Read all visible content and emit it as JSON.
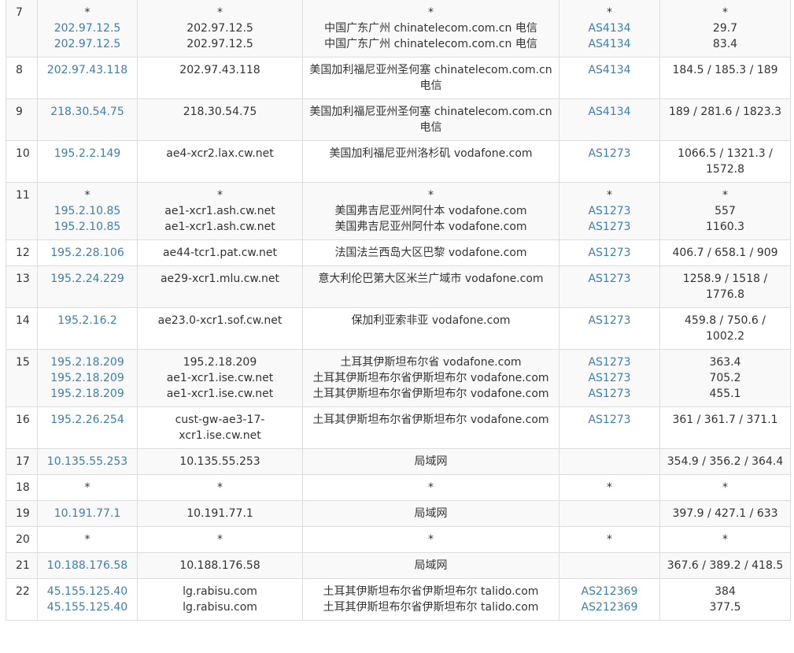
{
  "table": {
    "rows": [
      {
        "hop": "7",
        "ip": [
          "*",
          "202.97.12.5",
          "202.97.12.5"
        ],
        "host": [
          "*",
          "202.97.12.5",
          "202.97.12.5"
        ],
        "loc": [
          "*",
          "中国广东广州 chinatelecom.com.cn 电信",
          "中国广东广州 chinatelecom.com.cn 电信"
        ],
        "asn": [
          "*",
          "AS4134",
          "AS4134"
        ],
        "time": [
          "*",
          "29.7",
          "83.4"
        ]
      },
      {
        "hop": "8",
        "ip": [
          "202.97.43.118"
        ],
        "host": [
          "202.97.43.118"
        ],
        "loc": [
          "美国加利福尼亚州圣何塞 chinatelecom.com.cn 电信"
        ],
        "asn": [
          "AS4134"
        ],
        "time": [
          "184.5 / 185.3 / 189"
        ]
      },
      {
        "hop": "9",
        "ip": [
          "218.30.54.75"
        ],
        "host": [
          "218.30.54.75"
        ],
        "loc": [
          "美国加利福尼亚州圣何塞 chinatelecom.com.cn 电信"
        ],
        "asn": [
          "AS4134"
        ],
        "time": [
          "189 / 281.6 / 1823.3"
        ]
      },
      {
        "hop": "10",
        "ip": [
          "195.2.2.149"
        ],
        "host": [
          "ae4-xcr2.lax.cw.net"
        ],
        "loc": [
          "美国加利福尼亚州洛杉矶 vodafone.com"
        ],
        "asn": [
          "AS1273"
        ],
        "time": [
          "1066.5 / 1321.3 / 1572.8"
        ]
      },
      {
        "hop": "11",
        "ip": [
          "*",
          "195.2.10.85",
          "195.2.10.85"
        ],
        "host": [
          "*",
          "ae1-xcr1.ash.cw.net",
          "ae1-xcr1.ash.cw.net"
        ],
        "loc": [
          "*",
          "美国弗吉尼亚州阿什本 vodafone.com",
          "美国弗吉尼亚州阿什本 vodafone.com"
        ],
        "asn": [
          "*",
          "AS1273",
          "AS1273"
        ],
        "time": [
          "*",
          "557",
          "1160.3"
        ]
      },
      {
        "hop": "12",
        "ip": [
          "195.2.28.106"
        ],
        "host": [
          "ae44-tcr1.pat.cw.net"
        ],
        "loc": [
          "法国法兰西岛大区巴黎 vodafone.com"
        ],
        "asn": [
          "AS1273"
        ],
        "time": [
          "406.7 / 658.1 / 909"
        ]
      },
      {
        "hop": "13",
        "ip": [
          "195.2.24.229"
        ],
        "host": [
          "ae29-xcr1.mlu.cw.net"
        ],
        "loc": [
          "意大利伦巴第大区米兰广域市 vodafone.com"
        ],
        "asn": [
          "AS1273"
        ],
        "time": [
          "1258.9 / 1518 / 1776.8"
        ]
      },
      {
        "hop": "14",
        "ip": [
          "195.2.16.2"
        ],
        "host": [
          "ae23.0-xcr1.sof.cw.net"
        ],
        "loc": [
          "保加利亚索非亚 vodafone.com"
        ],
        "asn": [
          "AS1273"
        ],
        "time": [
          "459.8 / 750.6 / 1002.2"
        ]
      },
      {
        "hop": "15",
        "ip": [
          "195.2.18.209",
          "195.2.18.209",
          "195.2.18.209"
        ],
        "host": [
          "195.2.18.209",
          "ae1-xcr1.ise.cw.net",
          "ae1-xcr1.ise.cw.net"
        ],
        "loc": [
          "土耳其伊斯坦布尔省 vodafone.com",
          "土耳其伊斯坦布尔省伊斯坦布尔 vodafone.com",
          "土耳其伊斯坦布尔省伊斯坦布尔 vodafone.com"
        ],
        "asn": [
          "AS1273",
          "AS1273",
          "AS1273"
        ],
        "time": [
          "363.4",
          "705.2",
          "455.1"
        ]
      },
      {
        "hop": "16",
        "ip": [
          "195.2.26.254"
        ],
        "host": [
          "cust-gw-ae3-17-xcr1.ise.cw.net"
        ],
        "loc": [
          "土耳其伊斯坦布尔省伊斯坦布尔 vodafone.com"
        ],
        "asn": [
          "AS1273"
        ],
        "time": [
          "361 / 361.7 / 371.1"
        ]
      },
      {
        "hop": "17",
        "ip": [
          "10.135.55.253"
        ],
        "host": [
          "10.135.55.253"
        ],
        "loc": [
          "局域网"
        ],
        "asn": [],
        "time": [
          "354.9 / 356.2 / 364.4"
        ]
      },
      {
        "hop": "18",
        "ip": [
          "*"
        ],
        "host": [
          "*"
        ],
        "loc": [
          "*"
        ],
        "asn": [
          "*"
        ],
        "time": [
          "*"
        ]
      },
      {
        "hop": "19",
        "ip": [
          "10.191.77.1"
        ],
        "host": [
          "10.191.77.1"
        ],
        "loc": [
          "局域网"
        ],
        "asn": [],
        "time": [
          "397.9 / 427.1 / 633"
        ]
      },
      {
        "hop": "20",
        "ip": [
          "*"
        ],
        "host": [
          "*"
        ],
        "loc": [
          "*"
        ],
        "asn": [
          "*"
        ],
        "time": [
          "*"
        ]
      },
      {
        "hop": "21",
        "ip": [
          "10.188.176.58"
        ],
        "host": [
          "10.188.176.58"
        ],
        "loc": [
          "局域网"
        ],
        "asn": [],
        "time": [
          "367.6 / 389.2 / 418.5"
        ]
      },
      {
        "hop": "22",
        "ip": [
          "45.155.125.40",
          "45.155.125.40"
        ],
        "host": [
          "lg.rabisu.com",
          "lg.rabisu.com"
        ],
        "loc": [
          "土耳其伊斯坦布尔省伊斯坦布尔 talido.com",
          "土耳其伊斯坦布尔省伊斯坦布尔 talido.com"
        ],
        "asn": [
          "AS212369",
          "AS212369"
        ],
        "time": [
          "384",
          "377.5"
        ]
      }
    ]
  }
}
